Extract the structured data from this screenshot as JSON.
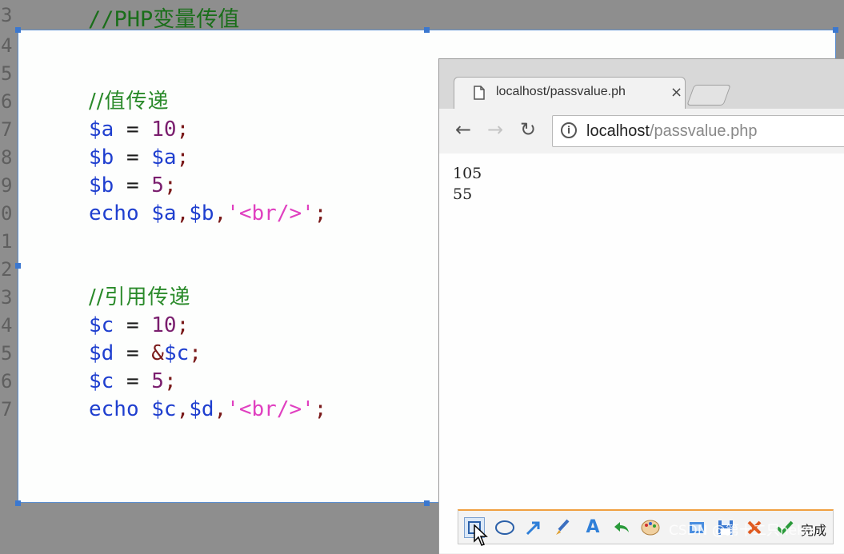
{
  "editor": {
    "line_numbers": [
      "3",
      "4",
      "5",
      "6",
      "7",
      "8",
      "9",
      "0",
      "1",
      "2",
      "3",
      "4",
      "5",
      "6",
      "7"
    ],
    "top_comment": "//PHP变量传值"
  },
  "code": {
    "block1": {
      "comment": "//值传递",
      "line1": {
        "var": "$a",
        "eq": " = ",
        "val": "10",
        "end": ";"
      },
      "line2": {
        "var": "$b",
        "eq": " = ",
        "val": "$a",
        "end": ";"
      },
      "line3": {
        "var": "$b",
        "eq": " = ",
        "val": "5",
        "end": ";"
      },
      "echo": {
        "kw": "echo ",
        "a": "$a",
        "c1": ",",
        "b": "$b",
        "c2": ",",
        "str": "'<br/>'",
        "end": ";"
      }
    },
    "block2": {
      "comment": "//引用传递",
      "line1": {
        "var": "$c",
        "eq": " = ",
        "val": "10",
        "end": ";"
      },
      "line2": {
        "var": "$d",
        "eq": " = ",
        "amp": "&",
        "val": "$c",
        "end": ";"
      },
      "line3": {
        "var": "$c",
        "eq": " = ",
        "val": "5",
        "end": ";"
      },
      "echo": {
        "kw": "echo ",
        "a": "$c",
        "c1": ",",
        "b": "$d",
        "c2": ",",
        "str": "'<br/>'",
        "end": ";"
      }
    }
  },
  "browser": {
    "tab_title": "localhost/passvalue.ph",
    "tab_close": "×",
    "back": "←",
    "forward": "→",
    "reload": "↻",
    "url_host": "localhost",
    "url_path": "/passvalue.php",
    "output": [
      "105",
      "55"
    ]
  },
  "snip_toolbar": {
    "done_label": "完成",
    "watermark": "CSDN @第十二只neko"
  }
}
